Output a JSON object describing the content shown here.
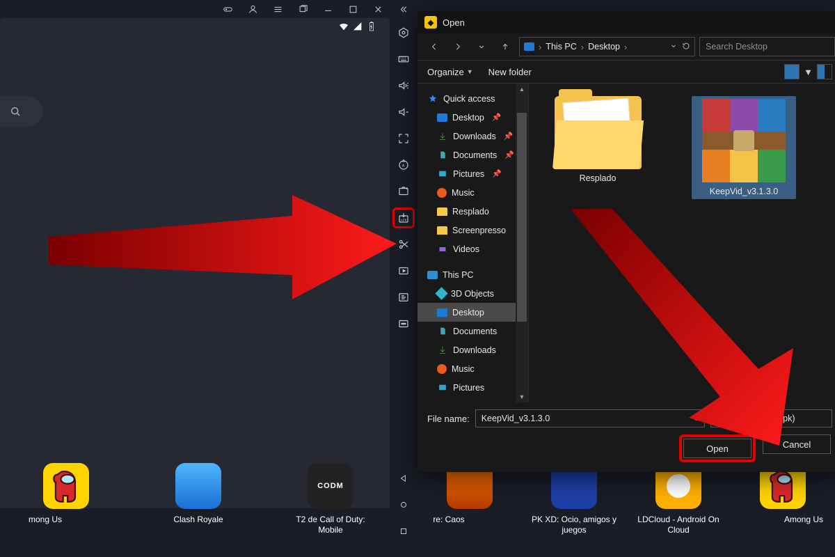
{
  "emulator": {
    "titlebar_icons": [
      "gamepad",
      "user",
      "menu",
      "multi-window",
      "minimize",
      "maximize",
      "close",
      "collapse"
    ],
    "statusbar_icons": [
      "wifi",
      "signal",
      "battery"
    ]
  },
  "sidebar": {
    "buttons": [
      "settings-hex",
      "keyboard",
      "volume-up",
      "volume-down",
      "fullscreen",
      "rotate",
      "screenshot",
      "install-apk",
      "scissors",
      "play-frame",
      "operation-record",
      "more"
    ],
    "nav": [
      "back-triangle",
      "home-circle",
      "recents-square"
    ]
  },
  "dock_left": [
    {
      "label": "mong Us",
      "icon": "among"
    },
    {
      "label": "Clash Royale",
      "icon": "clash"
    },
    {
      "label": "T2 de Call of Duty: Mobile",
      "icon": "cod"
    }
  ],
  "dock_right": [
    {
      "label": "re: Caos",
      "icon": "freefire"
    },
    {
      "label": "PK XD: Ocio, amigos y juegos",
      "icon": "pkxd"
    },
    {
      "label": "LDCloud - Android On Cloud",
      "icon": "ld"
    },
    {
      "label": "Among Us",
      "icon": "among"
    }
  ],
  "dialog": {
    "title": "Open",
    "breadcrumb": [
      "This PC",
      "Desktop"
    ],
    "search_placeholder": "Search Desktop",
    "organize": "Organize",
    "new_folder": "New folder",
    "nav_quick": "Quick access",
    "nav_quick_items": [
      {
        "label": "Desktop",
        "type": "desk",
        "pin": true
      },
      {
        "label": "Downloads",
        "type": "dl",
        "pin": true
      },
      {
        "label": "Documents",
        "type": "doc",
        "pin": true
      },
      {
        "label": "Pictures",
        "type": "pic",
        "pin": true
      },
      {
        "label": "Music",
        "type": "mus",
        "pin": false
      },
      {
        "label": "Resplado",
        "type": "fld",
        "pin": false
      },
      {
        "label": "Screenpresso",
        "type": "fld",
        "pin": false
      },
      {
        "label": "Videos",
        "type": "vid",
        "pin": false
      }
    ],
    "nav_thispc": "This PC",
    "nav_thispc_items": [
      {
        "label": "3D Objects",
        "type": "obj3d"
      },
      {
        "label": "Desktop",
        "type": "desk",
        "selected": true
      },
      {
        "label": "Documents",
        "type": "doc"
      },
      {
        "label": "Downloads",
        "type": "dl"
      },
      {
        "label": "Music",
        "type": "mus"
      },
      {
        "label": "Pictures",
        "type": "pic"
      }
    ],
    "files": [
      {
        "name": "Resplado",
        "kind": "folder"
      },
      {
        "name": "KeepVid_v3.1.3.0",
        "kind": "rar",
        "selected": true
      }
    ],
    "file_name_label": "File name:",
    "file_name_value": "KeepVid_v3.1.3.0",
    "filter": "Archivos APK(*.apk)",
    "open_btn": "Open",
    "cancel_btn": "Cancel"
  }
}
